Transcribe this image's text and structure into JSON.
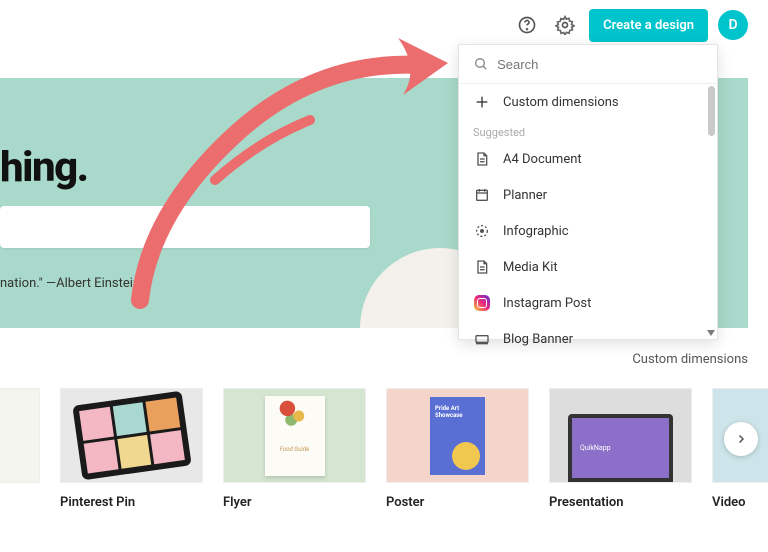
{
  "header": {
    "create_label": "Create a design",
    "avatar_initial": "D"
  },
  "hero": {
    "title_fragment": "hing.",
    "quote_fragment": "nation.\" —Albert Einstein"
  },
  "dropdown": {
    "search_placeholder": "Search",
    "custom_label": "Custom dimensions",
    "suggested_label": "Suggested",
    "items": [
      {
        "label": "A4 Document",
        "icon": "doc"
      },
      {
        "label": "Planner",
        "icon": "calendar"
      },
      {
        "label": "Infographic",
        "icon": "info"
      },
      {
        "label": "Media Kit",
        "icon": "doc"
      },
      {
        "label": "Instagram Post",
        "icon": "instagram"
      },
      {
        "label": "Blog Banner",
        "icon": "banner"
      }
    ]
  },
  "custom_dims_link": "Custom dimensions",
  "templates": [
    {
      "label": ""
    },
    {
      "label": "Pinterest Pin"
    },
    {
      "label": "Flyer"
    },
    {
      "label": "Poster"
    },
    {
      "label": "Presentation"
    },
    {
      "label": "Video"
    }
  ],
  "thumb_text": {
    "flyer": "Food Guide",
    "poster": "Pride Art Showcase",
    "presentation": "QuikNapp"
  }
}
